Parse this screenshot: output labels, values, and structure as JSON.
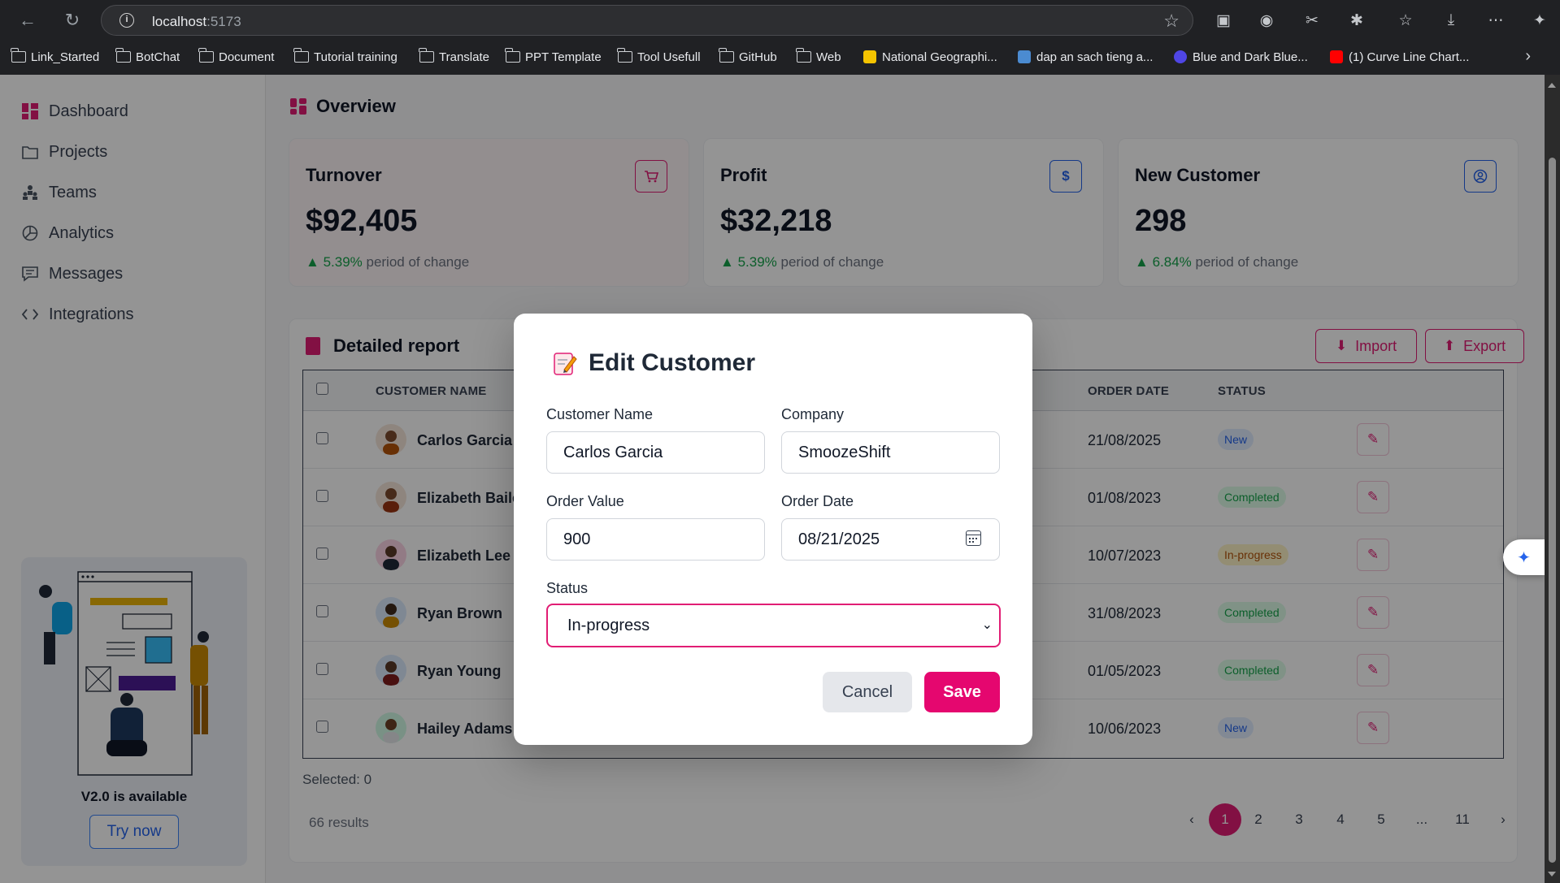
{
  "browser": {
    "url_host": "localhost",
    "url_port": ":5173",
    "bookmarks": [
      "Link_Started",
      "BotChat",
      "Document",
      "Tutorial training",
      "Translate",
      "PPT Template",
      "Tool Usefull",
      "GitHub",
      "Web",
      "National Geographi...",
      "dap an sach tieng a...",
      "Blue and Dark Blue...",
      "(1) Curve Line Chart..."
    ]
  },
  "sidebar": {
    "items": [
      {
        "label": "Dashboard",
        "icon": "dashboard-icon"
      },
      {
        "label": "Projects",
        "icon": "folder-icon"
      },
      {
        "label": "Teams",
        "icon": "teams-icon"
      },
      {
        "label": "Analytics",
        "icon": "pie-chart-icon"
      },
      {
        "label": "Messages",
        "icon": "message-icon"
      },
      {
        "label": "Integrations",
        "icon": "code-icon"
      }
    ],
    "promo": {
      "version_text": "V2.0 is available",
      "button_label": "Try now"
    }
  },
  "overview": {
    "title": "Overview",
    "cards": [
      {
        "title": "Turnover",
        "value": "$92,405",
        "change": "5.39%",
        "change_suffix": " period of change",
        "icon": "cart-icon",
        "accent": "#e11d74"
      },
      {
        "title": "Profit",
        "value": "$32,218",
        "change": "5.39%",
        "change_suffix": " period of change",
        "icon": "dollar-icon",
        "accent": "#2563eb"
      },
      {
        "title": "New Customer",
        "value": "298",
        "change": "6.84%",
        "change_suffix": " period of change",
        "icon": "user-icon",
        "accent": "#2563eb"
      }
    ]
  },
  "report": {
    "title": "Detailed report",
    "import_label": "Import",
    "export_label": "Export",
    "columns": {
      "name": "CUSTOMER NAME",
      "date": "ORDER DATE",
      "status": "STATUS"
    },
    "rows": [
      {
        "name": "Carlos Garcia",
        "date": "21/08/2025",
        "status": "New",
        "status_kind": "new"
      },
      {
        "name": "Elizabeth Baile",
        "date": "01/08/2023",
        "status": "Completed",
        "status_kind": "completed"
      },
      {
        "name": "Elizabeth Lee",
        "date": "10/07/2023",
        "status": "In-progress",
        "status_kind": "progress"
      },
      {
        "name": "Ryan Brown",
        "date": "31/08/2023",
        "status": "Completed",
        "status_kind": "completed"
      },
      {
        "name": "Ryan Young",
        "date": "01/05/2023",
        "status": "Completed",
        "status_kind": "completed"
      },
      {
        "name": "Hailey Adams",
        "date": "10/06/2023",
        "status": "New",
        "status_kind": "new"
      }
    ],
    "selected_text": "Selected: 0",
    "results_text": "66 results",
    "pagination": [
      "1",
      "2",
      "3",
      "4",
      "5",
      "...",
      "11"
    ],
    "current_page": "1"
  },
  "modal": {
    "title": "Edit Customer",
    "customer_name_label": "Customer Name",
    "customer_name_value": "Carlos Garcia",
    "company_label": "Company",
    "company_value": "SmoozeShift",
    "order_value_label": "Order Value",
    "order_value_value": "900",
    "order_date_label": "Order Date",
    "order_date_value": "08/21/2025",
    "status_label": "Status",
    "status_value": "In-progress",
    "cancel_label": "Cancel",
    "save_label": "Save"
  },
  "colors": {
    "accent": "#e11d74",
    "save": "#e5076f",
    "success": "#16a34a"
  }
}
